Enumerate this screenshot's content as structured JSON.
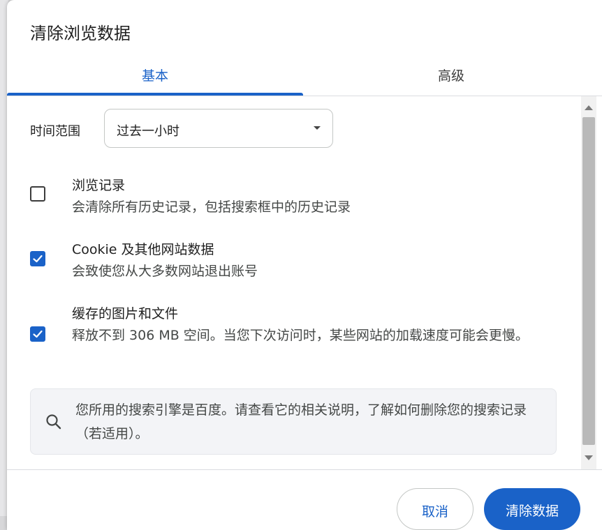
{
  "dialog": {
    "title": "清除浏览数据",
    "tabs": [
      {
        "label": "基本",
        "selected": true
      },
      {
        "label": "高级",
        "selected": false
      }
    ],
    "time_range": {
      "label": "时间范围",
      "value": "过去一小时"
    },
    "options": [
      {
        "title": "浏览记录",
        "description": "会清除所有历史记录，包括搜索框中的历史记录",
        "checked": false
      },
      {
        "title": "Cookie 及其他网站数据",
        "description": "会致使您从大多数网站退出账号",
        "checked": true
      },
      {
        "title": "缓存的图片和文件",
        "description": "释放不到 306 MB 空间。当您下次访问时，某些网站的加载速度可能会更慢。",
        "checked": true
      }
    ],
    "info": {
      "icon": "search-icon",
      "text": "您所用的搜索引擎是百度。请查看它的相关说明，了解如何删除您的搜索记录（若适用）。"
    },
    "buttons": {
      "cancel": "取消",
      "clear": "清除数据"
    }
  },
  "colors": {
    "accent": "#1a62c8",
    "text": "#1f1f1f",
    "secondary_text": "#444746"
  }
}
